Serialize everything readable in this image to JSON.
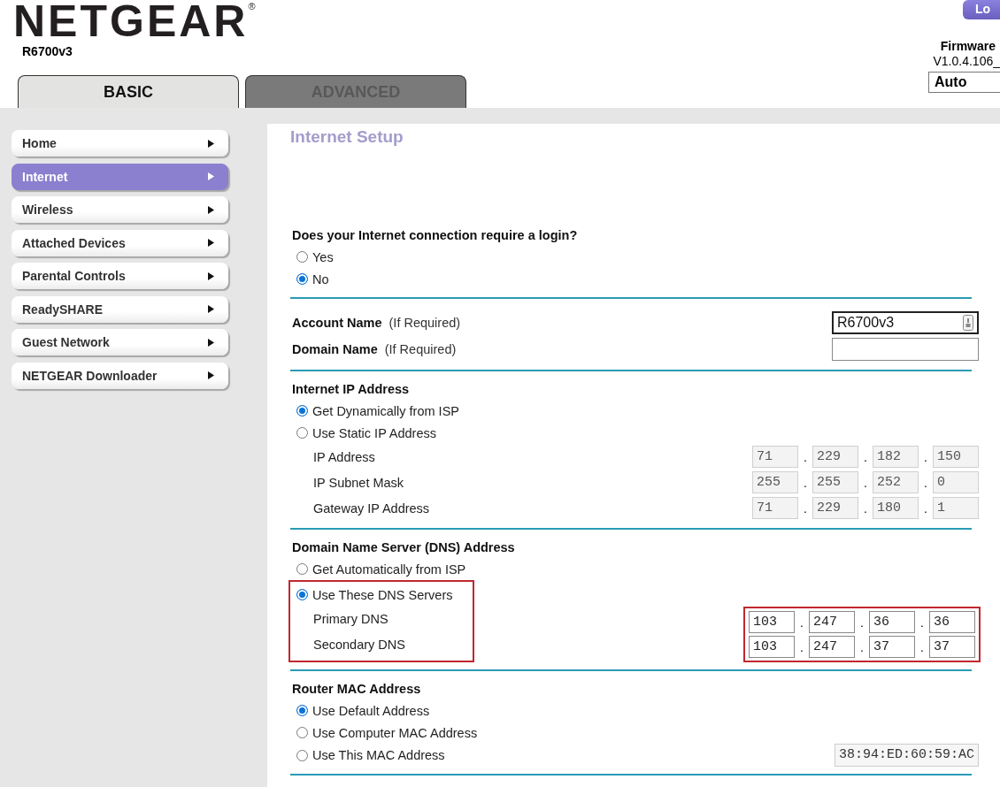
{
  "header": {
    "logo": "NETGEAR$^{®}$",
    "model": "R6700v3",
    "logout": "Lo",
    "firmware_label": "Firmware",
    "firmware_version": "V1.0.4.106_",
    "language": "Auto"
  },
  "tabs": [
    {
      "label": "BASIC",
      "selected": true
    },
    {
      "label": "ADVANCED",
      "selected": false
    }
  ],
  "sidebar": {
    "items": [
      {
        "label": "Home",
        "selected": false
      },
      {
        "label": "Internet",
        "selected": true
      },
      {
        "label": "Wireless",
        "selected": false
      },
      {
        "label": "Attached Devices",
        "selected": false
      },
      {
        "label": "Parental Controls",
        "selected": false
      },
      {
        "label": "ReadySHARE",
        "selected": false
      },
      {
        "label": "Guest Network",
        "selected": false
      },
      {
        "label": "NETGEAR Downloader",
        "selected": false
      }
    ]
  },
  "page_title": "Internet Setup",
  "sections": [
    {
      "heading": "Does your Internet connection require a login?",
      "rows": [
        {
          "kind": "radio",
          "label": "Yes",
          "selected": false
        },
        {
          "kind": "radio",
          "label": "No",
          "selected": true
        }
      ]
    },
    {
      "rows": [
        {
          "kind": "text",
          "label": "Account Name",
          "hint": "(If Required)",
          "value": "R6700v3",
          "focused": true
        },
        {
          "kind": "text",
          "label": "Domain Name",
          "hint": "(If Required)",
          "focused": false
        }
      ]
    },
    {
      "heading": "Internet IP Address",
      "rows": [
        {
          "kind": "radio",
          "label": "Get Dynamically from ISP",
          "selected": true
        },
        {
          "kind": "radio",
          "label": "Use Static IP Address",
          "selected": false
        },
        {
          "kind": "ip",
          "label": "IP Address",
          "octets": [
            "71",
            "229",
            "182",
            "150"
          ],
          "separator": ".",
          "disabled": true
        },
        {
          "kind": "ip",
          "label": "IP Subnet Mask",
          "octets": [
            "255",
            "255",
            "252",
            "0"
          ],
          "separator": ".",
          "disabled": true
        },
        {
          "kind": "ip",
          "label": "Gateway IP Address",
          "octets": [
            "71",
            "229",
            "180",
            "1"
          ],
          "separator": ".",
          "disabled": true
        }
      ]
    },
    {
      "heading": "Domain Name Server (DNS) Address",
      "rows": [
        {
          "kind": "radio",
          "label": "Get Automatically from ISP",
          "selected": false
        },
        {
          "kind": "group",
          "highlighted": true,
          "rows": [
            {
              "kind": "radio",
              "label": "Use These DNS Servers",
              "selected": true
            },
            {
              "kind": "ip",
              "label": "Primary DNS",
              "octets": [
                "103",
                "247",
                "36",
                "36"
              ],
              "separator": ".",
              "disabled": false
            },
            {
              "kind": "ip",
              "label": "Secondary DNS",
              "octets": [
                "103",
                "247",
                "37",
                "37"
              ],
              "separator": ".",
              "disabled": false
            }
          ]
        }
      ]
    },
    {
      "heading": "Router MAC Address",
      "rows": [
        {
          "kind": "radio",
          "label": "Use Default Address",
          "selected": true
        },
        {
          "kind": "radio",
          "label": "Use Computer MAC Address",
          "selected": false
        },
        {
          "kind": "radio",
          "label": "Use This MAC Address",
          "selected": false,
          "value": "38:94:ED:60:59:AC"
        }
      ]
    }
  ]
}
